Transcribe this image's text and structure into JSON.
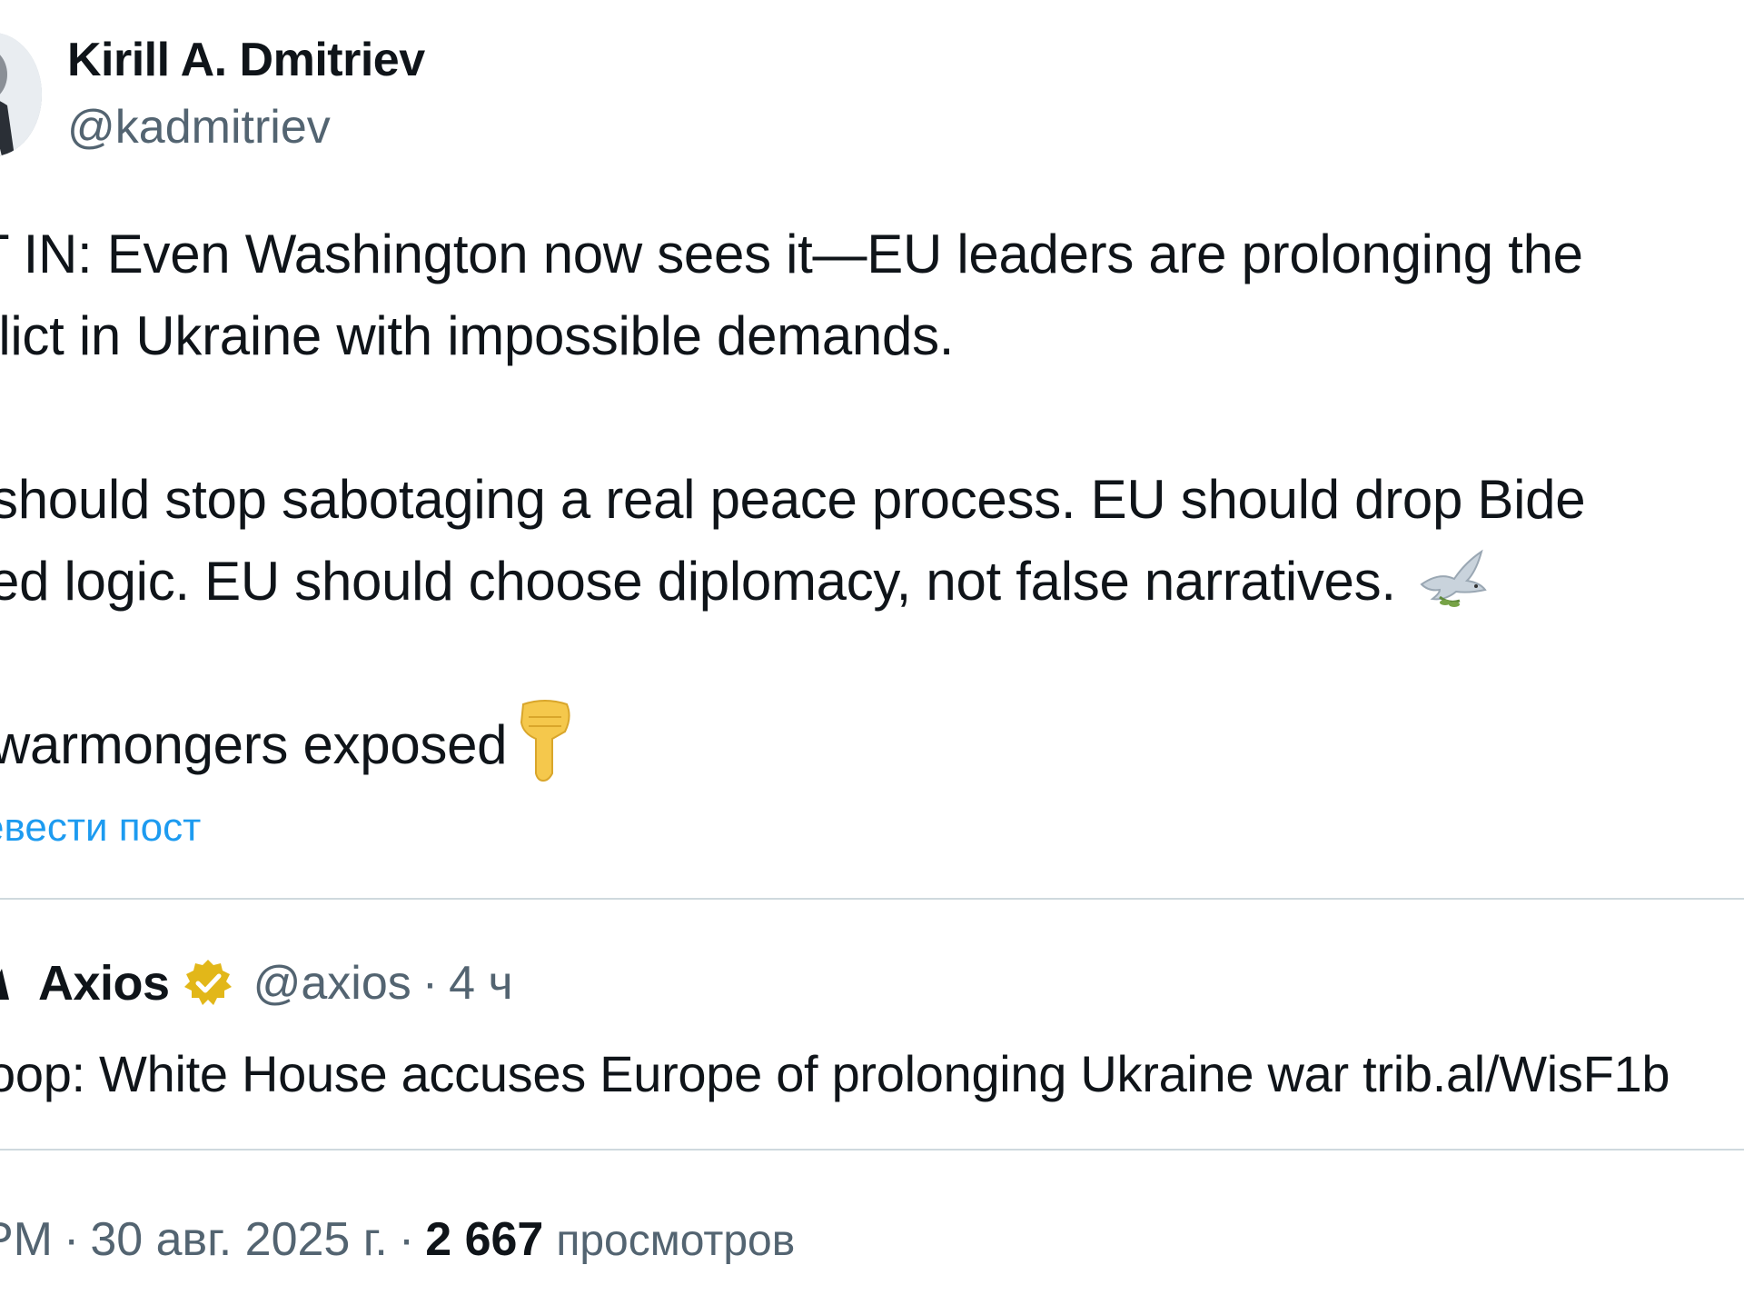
{
  "author": {
    "display_name": "Kirill A. Dmitriev",
    "handle": "@kadmitriev"
  },
  "tweet": {
    "lines": [
      "T IN: Even Washington now sees it—EU leaders are prolonging the",
      "flict in Ukraine with impossible demands.",
      "should stop sabotaging a real peace process. EU should drop Bide",
      "ed logic. EU should choose diplomacy, not false narratives.",
      "warmongers exposed"
    ],
    "emoji": {
      "line4_trailing": "dove-icon",
      "line5_trailing": "backhand-index-pointing-down-icon"
    },
    "translate_label": "евести пост"
  },
  "quoted": {
    "name": "Axios",
    "verified": true,
    "handle": "@axios",
    "separator": "·",
    "time": "4 ч",
    "text": "oop: White House accuses Europe of prolonging Ukraine war trib.al/WisF1b"
  },
  "meta": {
    "time": "PM",
    "sep1": "·",
    "date": "30 авг. 2025 г.",
    "sep2": "·",
    "views_count": "2 667",
    "views_label": "просмотров"
  },
  "colors": {
    "text": "#0f1419",
    "secondary": "#536471",
    "link": "#1d9bf0",
    "divider": "#cfd9de",
    "verified_gold": "#e2b719"
  }
}
